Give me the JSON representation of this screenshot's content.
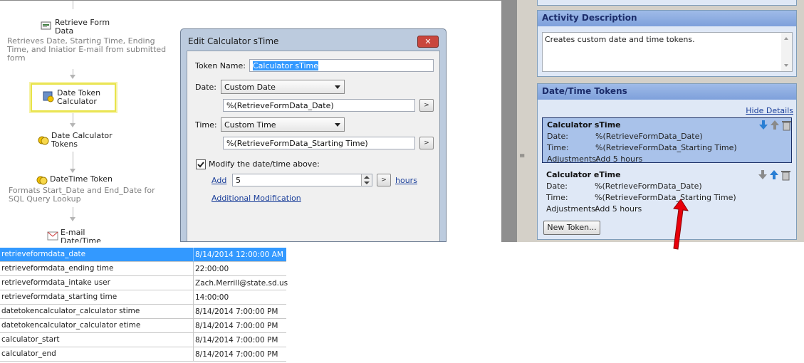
{
  "workflow": {
    "retrieve_form_label": "Retrieve Form\nData",
    "retrieve_form_desc": "Retrieves Date, Starting Time, Ending\nTime, and Iniatior E-mail from submitted\nform",
    "date_token_calc_label": "Date Token\nCalculator",
    "date_calc_tokens_label": "Date Calculator\nTokens",
    "datetime_token_label": "DateTime Token",
    "datetime_token_desc": "Formats Start_Date and End_Date for\nSQL Query Lookup",
    "email_label": "E-mail\nDate/Time"
  },
  "dialog": {
    "title": "Edit Calculator sTime",
    "close_label": "✕",
    "token_name_label": "Token Name:",
    "token_name_value": "Calculator sTime",
    "date_label": "Date:",
    "date_select": "Custom Date",
    "date_value": "%(RetrieveFormData_Date)",
    "time_label": "Time:",
    "time_select": "Custom Time",
    "time_value": "%(RetrieveFormData_Starting Time)",
    "modify_label": "Modify the date/time above:",
    "modify_checked": true,
    "add_link": "Add",
    "add_value": "5",
    "hours_link": "hours",
    "additional_mod_link": "Additional Modification",
    "browse_label": ">"
  },
  "right_pane": {
    "activity_header": "Activity Description",
    "activity_text": "Creates custom date and time tokens.",
    "tokens_header": "Date/Time Tokens",
    "hide_details": "Hide Details",
    "tokens": [
      {
        "name": "Calculator sTime",
        "date_label": "Date:",
        "date": "%(RetrieveFormData_Date)",
        "time_label": "Time:",
        "time": "%(RetrieveFormData_Starting Time)",
        "adj_label": "Adjustments:",
        "adjustments": "Add 5 hours"
      },
      {
        "name": "Calculator eTime",
        "date_label": "Date:",
        "date": "%(RetrieveFormData_Date)",
        "time_label": "Time:",
        "time": "%(RetrieveFormData_Starting Time)",
        "adj_label": "Adjustments:",
        "adjustments": "Add 5 hours"
      }
    ],
    "new_token_button": "New Token..."
  },
  "table": {
    "rows": [
      {
        "key": "retrieveformdata_date",
        "value": "8/14/2014 12:00:00 AM"
      },
      {
        "key": "retrieveformdata_ending time",
        "value": "22:00:00"
      },
      {
        "key": "retrieveformdata_intake user",
        "value": "Zach.Merrill@state.sd.us"
      },
      {
        "key": "retrieveformdata_starting time",
        "value": "14:00:00"
      },
      {
        "key": "datetokencalculator_calculator stime",
        "value": "8/14/2014 7:00:00 PM"
      },
      {
        "key": "datetokencalculator_calculator etime",
        "value": "8/14/2014 7:00:00 PM"
      },
      {
        "key": "calculator_start",
        "value": "8/14/2014 7:00:00 PM"
      },
      {
        "key": "calculator_end",
        "value": "8/14/2014 7:00:00 PM"
      }
    ]
  },
  "colors": {
    "selected_row": "#3399ff",
    "panel_header": "#7ea0db",
    "annotation_arrow": "#e8000a"
  }
}
